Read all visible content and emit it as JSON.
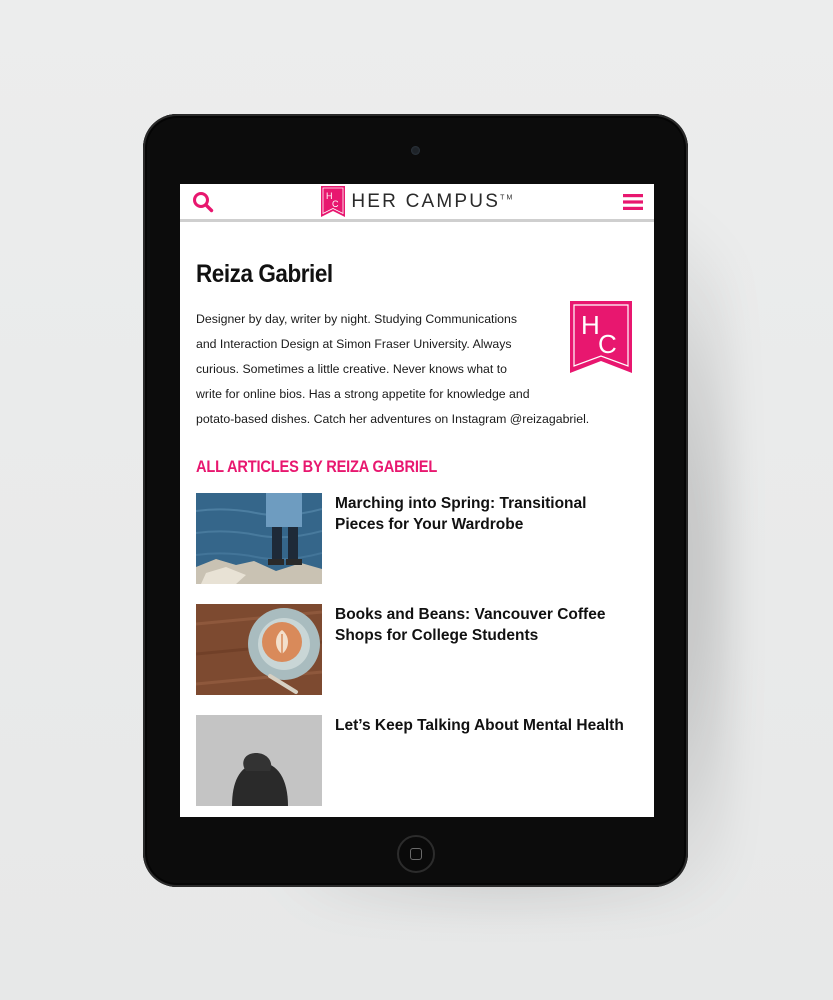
{
  "header": {
    "brand_mark": "HC",
    "brand_text": "HER CAMPUS",
    "brand_tm": "TM",
    "search_icon": "search-icon",
    "menu_icon": "hamburger-menu-icon"
  },
  "author": {
    "name": "Reiza Gabriel",
    "bio_lines": [
      "Designer by day, writer by night. Studying Communications",
      "and Interaction Design at Simon Fraser University. Always",
      "curious. Sometimes a little creative. Never knows what to",
      "write for online bios. Has a strong appetite for knowledge and",
      "potato-based dishes. Catch her adventures on Instagram @reizagabriel."
    ],
    "avatar_mark": "HC"
  },
  "articles_section": {
    "title": "ALL ARTICLES BY REIZA GABRIEL",
    "items": [
      {
        "title": "Marching into Spring: Transitional Pieces for Your Wardrobe"
      },
      {
        "title": "Books and Beans: Vancouver Coffee Shops for College Students"
      },
      {
        "title": "Let’s Keep Talking About Mental Health"
      }
    ]
  },
  "colors": {
    "brand_pink": "#e8176f",
    "tablet_bezel": "#0c0c0c"
  }
}
